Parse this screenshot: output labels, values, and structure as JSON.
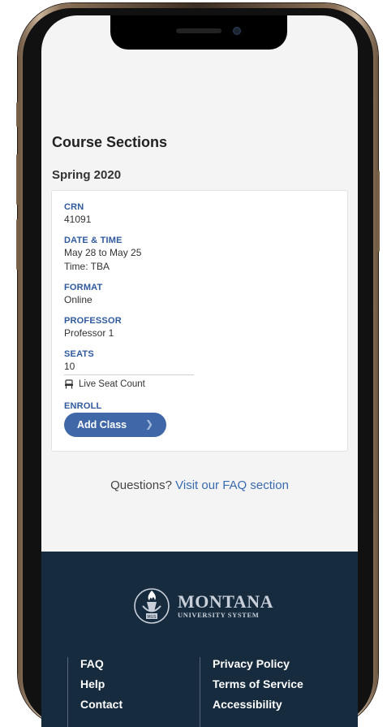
{
  "page": {
    "title": "Course Sections",
    "term": "Spring 2020"
  },
  "section": {
    "crn_label": "CRN",
    "crn": "41091",
    "datetime_label": "DATE & TIME",
    "date_range": "May 28 to May 25",
    "time": "Time: TBA",
    "format_label": "FORMAT",
    "format": "Online",
    "professor_label": "PROFESSOR",
    "professor": "Professor 1",
    "seats_label": "SEATS",
    "seats": "10",
    "live_seat_count": "Live Seat Count",
    "enroll_label": "ENROLL",
    "add_class": "Add Class",
    "add_class_icon": "chevron-right-icon"
  },
  "faq": {
    "prompt": "Questions?",
    "link": "Visit our FAQ section"
  },
  "footer": {
    "logo_main": "MONTANA",
    "logo_sub": "UNIVERSITY SYSTEM",
    "logo_badge": "MUS",
    "left_links": [
      "FAQ",
      "Help",
      "Contact"
    ],
    "right_links": [
      "Privacy Policy",
      "Terms of Service",
      "Accessibility"
    ]
  },
  "colors": {
    "accent": "#2f5a9e",
    "button": "#4068a8",
    "footer_bg": "#172b3e"
  }
}
